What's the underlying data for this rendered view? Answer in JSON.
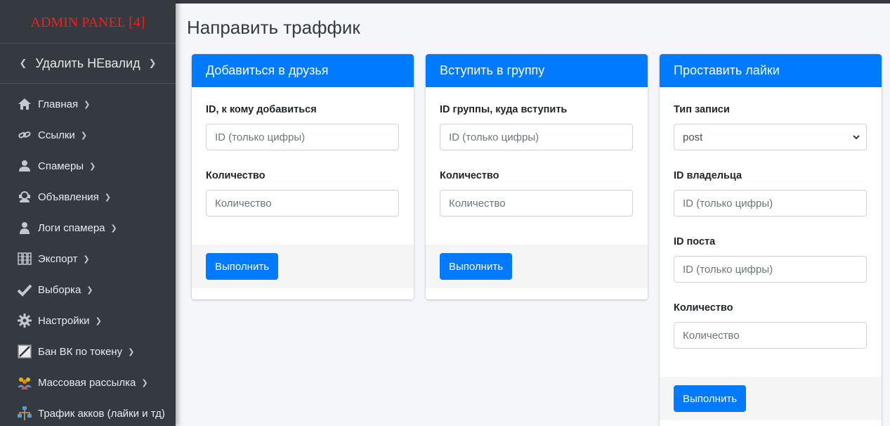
{
  "sidebar": {
    "brand": "ADMIN PANEL [4]",
    "user_label": "Удалить НЕвалид",
    "items": [
      {
        "label": "Главная",
        "icon": "home-icon"
      },
      {
        "label": "Ссылки",
        "icon": "link-icon"
      },
      {
        "label": "Спамеры",
        "icon": "user-icon"
      },
      {
        "label": "Объявления",
        "icon": "support-icon"
      },
      {
        "label": "Логи спамера",
        "icon": "user-log-icon"
      },
      {
        "label": "Экспорт",
        "icon": "export-icon"
      },
      {
        "label": "Выборка",
        "icon": "check-icon"
      },
      {
        "label": "Настройки",
        "icon": "gear-icon"
      },
      {
        "label": "Бан ВК по токену",
        "icon": "ban-icon"
      },
      {
        "label": "Массовая рассылка",
        "icon": "people-icon"
      },
      {
        "label": "Трафик акков (лайки и тд)",
        "icon": "network-icon"
      }
    ]
  },
  "page": {
    "title": "Направить траффик"
  },
  "cards": {
    "friends": {
      "header": "Добавиться в друзья",
      "id_label": "ID, к кому добавиться",
      "id_placeholder": "ID (только цифры)",
      "count_label": "Количество",
      "count_placeholder": "Количество",
      "submit": "Выполнить"
    },
    "group": {
      "header": "Вступить в группу",
      "id_label": "ID группы, куда вступить",
      "id_placeholder": "ID (только цифры)",
      "count_label": "Количество",
      "count_placeholder": "Количество",
      "submit": "Выполнить"
    },
    "likes": {
      "header": "Проставить лайки",
      "type_label": "Тип записи",
      "type_value": "post",
      "owner_label": "ID владельца",
      "owner_placeholder": "ID (только цифры)",
      "post_label": "ID поста",
      "post_placeholder": "ID (только цифры)",
      "count_label": "Количество",
      "count_placeholder": "Количество",
      "submit": "Выполнить"
    }
  },
  "colors": {
    "sidebar_bg": "#343a40",
    "brand_red": "#ff1a1a",
    "primary": "#007bff",
    "content_bg": "#f4f6f9"
  }
}
